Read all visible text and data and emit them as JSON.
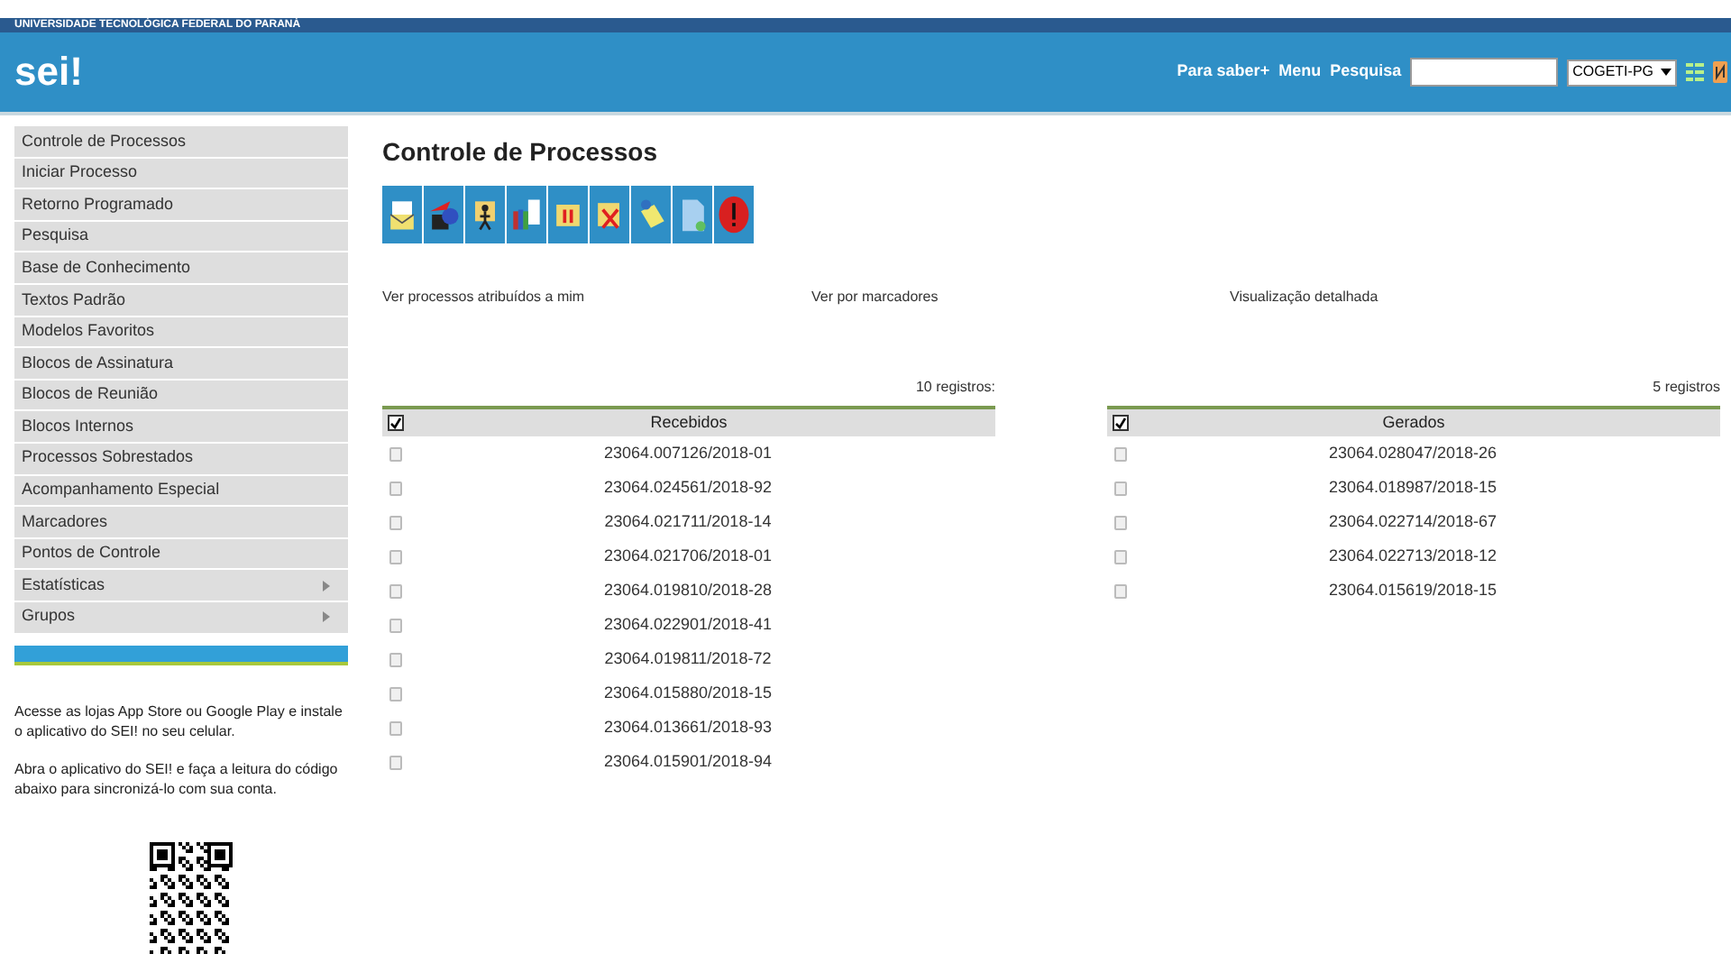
{
  "header": {
    "institution": "UNIVERSIDADE TECNOLÓGICA FEDERAL DO PARANÁ",
    "logo": "sei!",
    "links": [
      "Para saber+",
      "Menu",
      "Pesquisa"
    ],
    "unit_select": {
      "value": "COGETI-PG"
    }
  },
  "sidebar": {
    "items": [
      {
        "label": "Controle de Processos",
        "submenu": false
      },
      {
        "label": "Iniciar Processo",
        "submenu": false
      },
      {
        "label": "Retorno Programado",
        "submenu": false
      },
      {
        "label": "Pesquisa",
        "submenu": false
      },
      {
        "label": "Base de Conhecimento",
        "submenu": false
      },
      {
        "label": "Textos Padrão",
        "submenu": false
      },
      {
        "label": "Modelos Favoritos",
        "submenu": false
      },
      {
        "label": "Blocos de Assinatura",
        "submenu": false
      },
      {
        "label": "Blocos de Reunião",
        "submenu": false
      },
      {
        "label": "Blocos Internos",
        "submenu": false
      },
      {
        "label": "Processos Sobrestados",
        "submenu": false
      },
      {
        "label": "Acompanhamento Especial",
        "submenu": false
      },
      {
        "label": "Marcadores",
        "submenu": false
      },
      {
        "label": "Pontos de Controle",
        "submenu": false
      },
      {
        "label": "Estatísticas",
        "submenu": true
      },
      {
        "label": "Grupos",
        "submenu": true
      }
    ],
    "app_notes": [
      "Acesse as lojas App Store ou Google Play e instale o aplicativo do SEI! no seu celular.",
      "Abra o aplicativo do SEI! e faça a leitura do código abaixo para sincronizá-lo com sua conta."
    ]
  },
  "main": {
    "title": "Controle de Processos",
    "toolbar": [
      {
        "kind": "envelope"
      },
      {
        "kind": "send"
      },
      {
        "kind": "person"
      },
      {
        "kind": "books"
      },
      {
        "kind": "pause"
      },
      {
        "kind": "cancel"
      },
      {
        "kind": "notepad"
      },
      {
        "kind": "newdoc"
      },
      {
        "kind": "alert"
      }
    ],
    "view_links": [
      "Ver processos atribuídos a mim",
      "Ver por marcadores",
      "Visualização detalhada"
    ],
    "tables": [
      {
        "count": "10 registros:",
        "column": "Recebidos",
        "all_checked": true,
        "rows": [
          {
            "number": "23064.007126/2018-01",
            "checked": false
          },
          {
            "number": "23064.024561/2018-92",
            "checked": false
          },
          {
            "number": "23064.021711/2018-14",
            "checked": false
          },
          {
            "number": "23064.021706/2018-01",
            "checked": false
          },
          {
            "number": "23064.019810/2018-28",
            "checked": false
          },
          {
            "number": "23064.022901/2018-41",
            "checked": false
          },
          {
            "number": "23064.019811/2018-72",
            "checked": false
          },
          {
            "number": "23064.015880/2018-15",
            "checked": false
          },
          {
            "number": "23064.013661/2018-93",
            "checked": false
          },
          {
            "number": "23064.015901/2018-94",
            "checked": false
          }
        ]
      },
      {
        "count": "5 registros",
        "column": "Gerados",
        "all_checked": true,
        "rows": [
          {
            "number": "23064.028047/2018-26",
            "checked": false
          },
          {
            "number": "23064.018987/2018-15",
            "checked": false
          },
          {
            "number": "23064.022714/2018-67",
            "checked": false
          },
          {
            "number": "23064.022713/2018-12",
            "checked": false
          },
          {
            "number": "23064.015619/2018-15",
            "checked": false
          }
        ]
      }
    ]
  }
}
